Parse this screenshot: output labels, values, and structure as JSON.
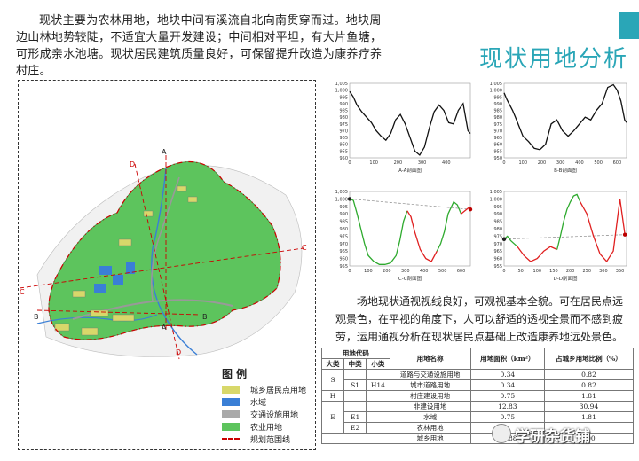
{
  "intro_text": "现状主要为农林用地，地块中间有溪流自北向南贯穿而过。地块周边山林地势较陡，不适宜大量开发建设；中间相对平坦，有大片鱼塘，可形成亲水池塘。现状居民建筑质量良好，可保留提升改造为康养疗养村庄。",
  "page_title": "现状用地分析",
  "map": {
    "section_labels": [
      "A",
      "A",
      "B",
      "B",
      "C",
      "C",
      "D",
      "D"
    ]
  },
  "legend": {
    "title": "图  例",
    "items": [
      {
        "label": "城乡居民点用地",
        "color": "#d8d86a"
      },
      {
        "label": "水域",
        "color": "#3a7fd6"
      },
      {
        "label": "交通设施用地",
        "color": "#a9a9a9"
      },
      {
        "label": "农业用地",
        "color": "#5dc45d"
      },
      {
        "label": "规划范围线",
        "color": "#cc0000"
      }
    ]
  },
  "chart_data": [
    {
      "type": "line",
      "title": "A-A剖面图",
      "ylim": [
        950,
        1005
      ],
      "yticks": [
        "1,005",
        "1,000",
        "995",
        "990",
        "985",
        "980",
        "975",
        "970",
        "965",
        "960",
        "955",
        "950"
      ],
      "xticks": [
        "0",
        "100",
        "200",
        "300",
        "400"
      ],
      "xlim": [
        0,
        500
      ],
      "series": [
        {
          "color": "#111",
          "x": [
            0,
            15,
            30,
            50,
            70,
            90,
            110,
            130,
            150,
            170,
            190,
            210,
            230,
            250,
            270,
            290,
            310,
            330,
            350,
            370,
            390,
            410,
            430,
            450,
            470,
            490,
            500
          ],
          "y": [
            999,
            995,
            989,
            984,
            980,
            976,
            970,
            966,
            963,
            968,
            978,
            982,
            975,
            965,
            955,
            952,
            958,
            972,
            984,
            989,
            985,
            976,
            975,
            985,
            990,
            970,
            968
          ]
        }
      ]
    },
    {
      "type": "line",
      "title": "B-B剖面图",
      "ylim": [
        950,
        1005
      ],
      "yticks": [
        "1,005",
        "1,000",
        "995",
        "990",
        "985",
        "980",
        "975",
        "970",
        "965",
        "960",
        "955",
        "950"
      ],
      "xticks": [
        "0",
        "100",
        "200",
        "300",
        "400",
        "500",
        "600"
      ],
      "xlim": [
        0,
        650
      ],
      "series": [
        {
          "color": "#111",
          "x": [
            0,
            15,
            30,
            45,
            60,
            80,
            100,
            130,
            160,
            190,
            220,
            250,
            280,
            310,
            340,
            370,
            400,
            430,
            460,
            490,
            520,
            550,
            580,
            600,
            620,
            640,
            650
          ],
          "y": [
            998,
            993,
            989,
            985,
            980,
            973,
            966,
            962,
            957,
            956,
            960,
            975,
            978,
            970,
            966,
            970,
            975,
            980,
            978,
            985,
            990,
            1002,
            1004,
            1000,
            992,
            978,
            976
          ]
        }
      ]
    },
    {
      "type": "line",
      "title": "C-C剖面图",
      "ylim": [
        955,
        1005
      ],
      "yticks": [
        "1,005",
        "1,000",
        "995",
        "990",
        "985",
        "980",
        "975",
        "970",
        "965",
        "960",
        "955"
      ],
      "xticks": [
        "0",
        "100",
        "200",
        "300",
        "400",
        "500",
        "600"
      ],
      "xlim": [
        0,
        650
      ],
      "series": [
        {
          "name": "green",
          "color": "#2eaa2e",
          "x": [
            0,
            20,
            40,
            60,
            80,
            100,
            130,
            160,
            190,
            220,
            250,
            270,
            290,
            310
          ],
          "y": [
            1000,
            999,
            990,
            980,
            970,
            962,
            958,
            956,
            956,
            957,
            962,
            972,
            985,
            992
          ]
        },
        {
          "name": "red",
          "color": "#e02020",
          "x": [
            310,
            330,
            350,
            380,
            410,
            440,
            470
          ],
          "y": [
            992,
            988,
            978,
            966,
            960,
            958,
            965
          ]
        },
        {
          "name": "green2",
          "color": "#2eaa2e",
          "x": [
            470,
            490,
            510,
            530,
            560,
            580,
            600
          ],
          "y": [
            965,
            970,
            978,
            990,
            998,
            996,
            990
          ]
        },
        {
          "name": "red2",
          "color": "#e02020",
          "x": [
            600,
            620,
            640,
            650
          ],
          "y": [
            990,
            992,
            994,
            993
          ]
        }
      ],
      "sightline": {
        "x": [
          0,
          650
        ],
        "y": [
          1000,
          993
        ]
      }
    },
    {
      "type": "line",
      "title": "D-D剖面图",
      "ylim": [
        955,
        1005
      ],
      "yticks": [
        "1,005",
        "1,000",
        "995",
        "990",
        "985",
        "980",
        "975",
        "970",
        "965",
        "960",
        "955"
      ],
      "xticks": [
        "0",
        "50",
        "100",
        "150",
        "200",
        "250",
        "300",
        "350"
      ],
      "xlim": [
        0,
        370
      ],
      "series": [
        {
          "name": "green",
          "color": "#2eaa2e",
          "x": [
            0,
            10,
            20,
            30,
            40
          ],
          "y": [
            973,
            975,
            972,
            970,
            968
          ]
        },
        {
          "name": "red",
          "color": "#e02020",
          "x": [
            40,
            60,
            80,
            100,
            120,
            140,
            160
          ],
          "y": [
            968,
            962,
            958,
            960,
            965,
            968,
            966
          ]
        },
        {
          "name": "green2",
          "color": "#2eaa2e",
          "x": [
            160,
            170,
            180,
            190,
            200,
            210,
            220,
            230
          ],
          "y": [
            966,
            975,
            985,
            993,
            998,
            1002,
            1003,
            998
          ]
        },
        {
          "name": "red2",
          "color": "#e02020",
          "x": [
            230,
            250,
            270,
            290,
            310,
            330,
            350,
            365
          ],
          "y": [
            998,
            990,
            975,
            963,
            958,
            965,
            1000,
            976
          ]
        }
      ],
      "sightline": {
        "x": [
          0,
          365
        ],
        "y": [
          973,
          976
        ]
      }
    }
  ],
  "analysis_text": "场地现状通视视线良好，可观视基本全貌。可在居民点远观景色，在平视的角度下，人可以舒适的透视全景而不感到疲劳，运用通视分析在现状居民点基础上改造康养地远处景色。",
  "table": {
    "header1": {
      "code": "用地代码",
      "name": "用地名称",
      "area": "用地面积（km²）",
      "ratio": "占城乡用地比例（%）"
    },
    "header2": {
      "big": "大类",
      "mid": "中类",
      "small": "小类"
    },
    "rows": [
      {
        "big": "S",
        "mid": "",
        "small": "",
        "name": "道路与交通设施用地",
        "area": "0.34",
        "ratio": "0.82"
      },
      {
        "big": "",
        "mid": "S1",
        "small": "H14",
        "name": "城市道路用地",
        "area": "0.34",
        "ratio": "0.82"
      },
      {
        "big": "H",
        "mid": "",
        "small": "",
        "name": "村庄建设用地",
        "area": "0.75",
        "ratio": "1.81"
      },
      {
        "big": "",
        "mid": "",
        "small": "",
        "name": "非建设用地",
        "area": "12.83",
        "ratio": "30.94"
      },
      {
        "big": "E",
        "mid": "E1",
        "small": "",
        "name": "水域",
        "area": "0.75",
        "ratio": "1.81"
      },
      {
        "big": "",
        "mid": "E2",
        "small": "",
        "name": "农林用地",
        "area": "",
        "ratio": ""
      },
      {
        "big": "",
        "mid": "",
        "small": "",
        "name": "城乡用地",
        "area": "13.88",
        "ratio": "100"
      }
    ]
  },
  "watermark": "学研杂货铺"
}
